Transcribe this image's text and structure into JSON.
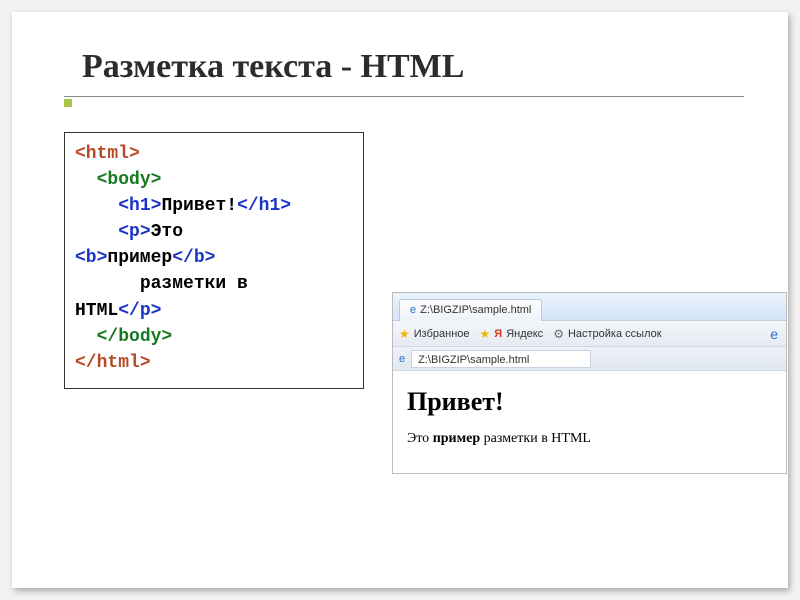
{
  "title": "Разметка текста - HTML",
  "code": {
    "l1_tag": "<html>",
    "l2_indent": "  ",
    "l2_tag": "<body>",
    "l3_indent": "    ",
    "l3_open": "<h1>",
    "l3_text": "Привет!",
    "l3_close": "</h1>",
    "l4_indent": "    ",
    "l4_open": "<p>",
    "l4_text": "Это",
    "l5_open": "<b>",
    "l5_text": "пример",
    "l5_close": "</b>",
    "l6_indent": "      ",
    "l6_text": "разметки в",
    "l7_text": "HTML",
    "l7_close": "</p>",
    "l8_indent": "  ",
    "l8_tag": "</body>",
    "l9_tag": "</html>"
  },
  "browser": {
    "tab_label": "Z:\\BIGZIP\\sample.html",
    "fav_label": "Избранное",
    "yandex_label": "Яндекс",
    "links_label": "Настройка ссылок",
    "yandex_icon": "Я",
    "address": "Z:\\BIGZIP\\sample.html",
    "page": {
      "h1": "Привет!",
      "p_before": "Это ",
      "p_bold": "пример",
      "p_after": " разметки в HTML"
    }
  }
}
